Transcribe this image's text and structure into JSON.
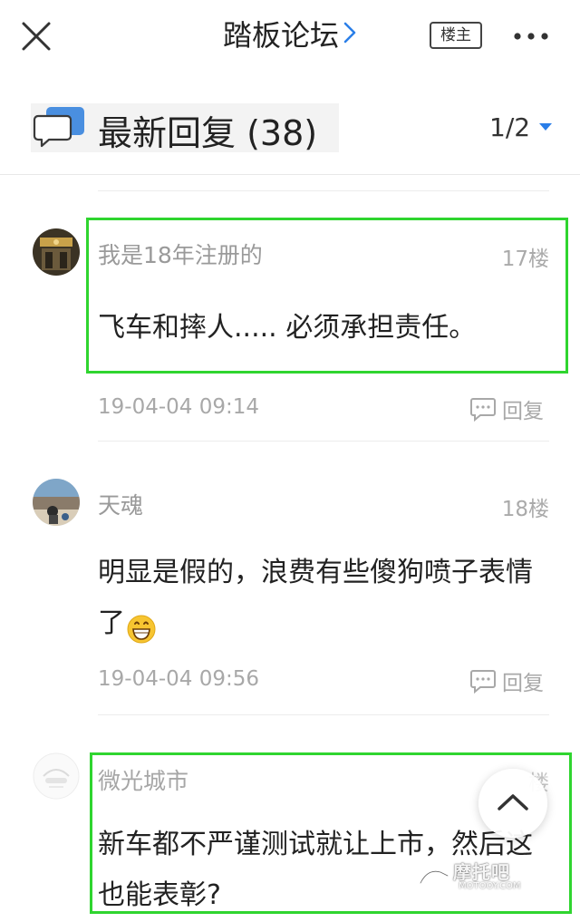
{
  "header": {
    "title": "踏板论坛",
    "owner_only_label": "楼主"
  },
  "section": {
    "title": "最新回复 (38)",
    "pager": "1/2"
  },
  "posts": [
    {
      "username": "我是18年注册的",
      "floor": "17楼",
      "content": "飞车和摔人.....   必须承担责任。",
      "timestamp": "19-04-04 09:14",
      "reply_label": "回复"
    },
    {
      "username": "天魂",
      "floor": "18楼",
      "content": "明显是假的，浪费有些傻狗喷子表情了",
      "emoji": "grinning-face-emoji",
      "timestamp": "19-04-04 09:56",
      "reply_label": "回复"
    },
    {
      "username": "微光城市",
      "floor": "楼",
      "content": "新车都不严谨测试就让上市，然后这也能表彰?"
    }
  ],
  "watermark": {
    "text": "摩托吧",
    "sub": "MOTOOY.COM"
  },
  "icons": {
    "close": "close-icon",
    "chevron": "chevron-right-icon",
    "more": "more-dots-icon",
    "section": "chat-bubbles-icon",
    "reply": "comment-icon",
    "scroll_top": "chevron-up-icon"
  },
  "colors": {
    "accent": "#2a7ee8",
    "highlight": "#2fd52f",
    "muted_text": "#a8a8a8"
  }
}
